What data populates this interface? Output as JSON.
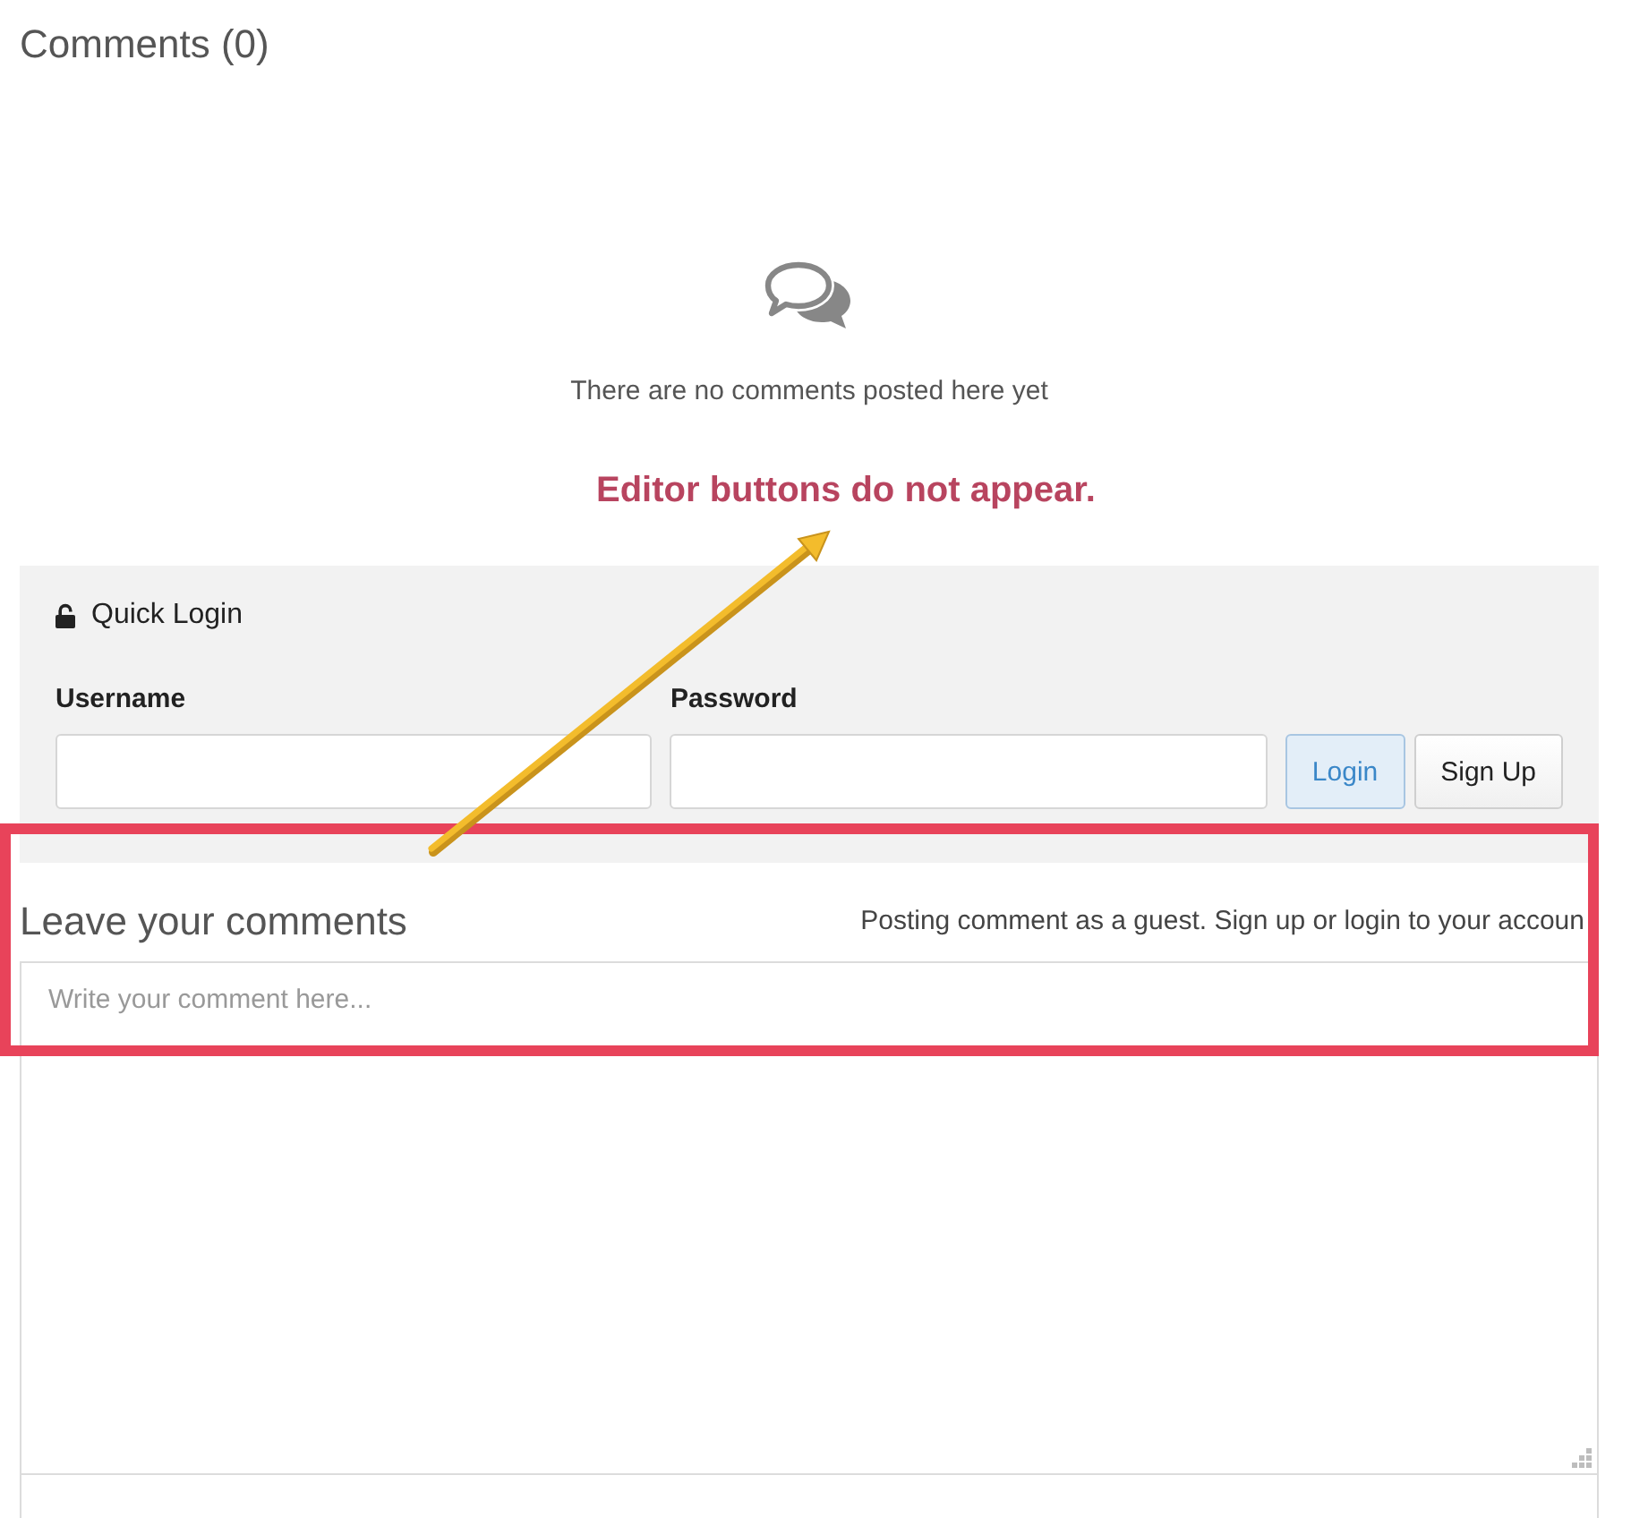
{
  "page_title": "Comments (0)",
  "empty_state": {
    "message": "There are no comments posted here yet"
  },
  "annotation": {
    "text": "Editor buttons do not appear."
  },
  "quick_login": {
    "title": "Quick Login",
    "fields": [
      {
        "label": "Username"
      },
      {
        "label": "Password"
      }
    ],
    "buttons": [
      {
        "label": "Login",
        "kind": "primary"
      },
      {
        "label": "Sign Up",
        "kind": "default"
      }
    ]
  },
  "comment_form": {
    "title": "Leave your comments",
    "guest_notice": "Posting comment as a guest. Sign up or login to your accoun",
    "placeholder": "Write your comment here..."
  }
}
